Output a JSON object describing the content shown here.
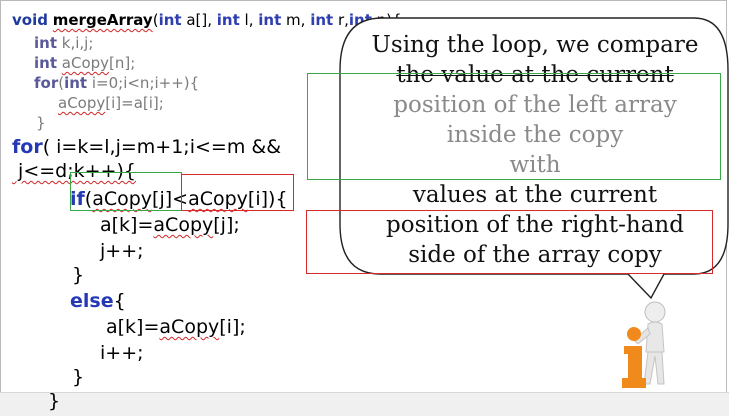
{
  "code": {
    "signature": {
      "kw1": "void",
      "name": "mergeArray",
      "p1a": "(",
      "p1kw": "int",
      "p1b": " a[], ",
      "p2kw": "int",
      "p2b": " l, ",
      "p3kw": "int",
      "p3b": " m, ",
      "p4kw": "int",
      "p4b": " r,",
      "p5kw": "int",
      "p5b": " n){"
    },
    "line2": {
      "kw": "int",
      "rest": " k,i,j;"
    },
    "line3": {
      "kw": "int",
      "var": "aCopy",
      "rest": "[n];"
    },
    "line4": {
      "kw": "for",
      "open": "(",
      "kw2": "int",
      "rest": " i=0;i<n;i++){"
    },
    "line5": {
      "var": "aCopy",
      "rest": "[i]=a[i];"
    },
    "line6": "}",
    "for_line": {
      "kw": "for",
      "rest": "( i=k=l,j=m+1;i<=m &&"
    },
    "cond_line": " j<=d;k++){",
    "if_line": {
      "kw": "if",
      "open": "(",
      "left": "aCopy",
      "left_idx": "[j]",
      "op": "<",
      "right": "aCopy",
      "right_idx": "[i]",
      "close": "){"
    },
    "assign_j": {
      "pre": "a[k]=",
      "var": "aCopy",
      "post": "[j];"
    },
    "inc_j": "j++;",
    "close1": "}",
    "else_kw": "else",
    "else_brace": "{",
    "assign_i": {
      "pre": "a[k]=",
      "var": "aCopy",
      "post": "[i];"
    },
    "inc_i": "i++;",
    "close2": "}",
    "close3": "}"
  },
  "callout": {
    "line1": "Using the loop, we compare",
    "line2": "the value at the current",
    "line3": "position of the left array",
    "line4": "inside the copy",
    "line5": "with",
    "line6": "values at the current",
    "line7": "position of the right-hand",
    "line8": "side of the array copy"
  },
  "colors": {
    "keyword": "#1f3a9e",
    "green_box": "#3aa84a",
    "red_box": "#d82a2a",
    "figure": "#f08a1c"
  },
  "figure": {
    "glyph": "i"
  }
}
